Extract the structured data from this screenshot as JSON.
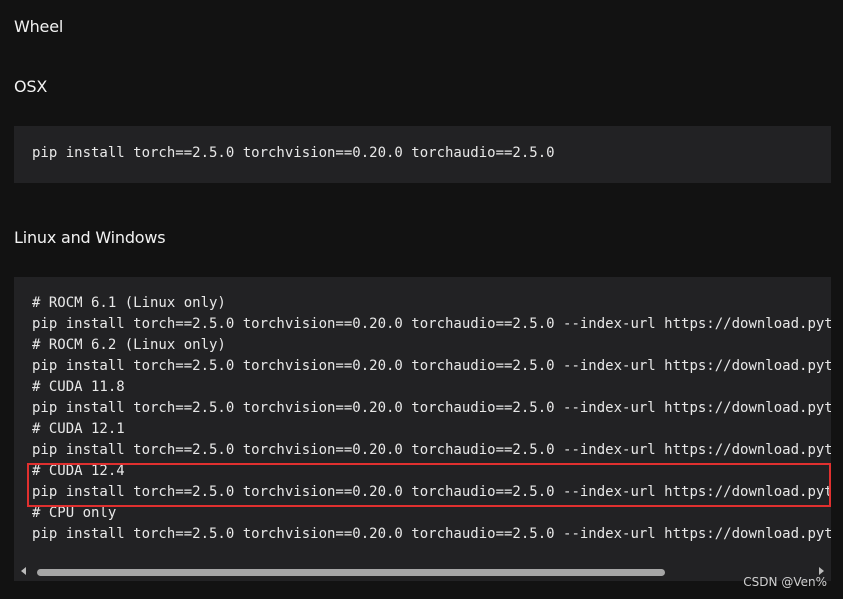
{
  "headings": {
    "wheel": "Wheel",
    "osx": "OSX",
    "linux_windows": "Linux and Windows"
  },
  "osx_code": "pip install torch==2.5.0 torchvision==0.20.0 torchaudio==2.5.0",
  "linux_code_lines": [
    "# ROCM 6.1 (Linux only)",
    "pip install torch==2.5.0 torchvision==0.20.0 torchaudio==2.5.0 --index-url https://download.pyt",
    "# ROCM 6.2 (Linux only)",
    "pip install torch==2.5.0 torchvision==0.20.0 torchaudio==2.5.0 --index-url https://download.pyt",
    "# CUDA 11.8",
    "pip install torch==2.5.0 torchvision==0.20.0 torchaudio==2.5.0 --index-url https://download.pyt",
    "# CUDA 12.1",
    "pip install torch==2.5.0 torchvision==0.20.0 torchaudio==2.5.0 --index-url https://download.pyt",
    "# CUDA 12.4",
    "pip install torch==2.5.0 torchvision==0.20.0 torchaudio==2.5.0 --index-url https://download.pyt",
    "# CPU only",
    "pip install torch==2.5.0 torchvision==0.20.0 torchaudio==2.5.0 --index-url https://download.pyt"
  ],
  "watermark": "CSDN @Ven%",
  "colors": {
    "page_bg": "#121212",
    "code_bg": "#222224",
    "highlight_border": "#e0302f"
  },
  "icons": {
    "scroll_left": "scroll-left-arrow-icon",
    "scroll_right": "scroll-right-arrow-icon"
  }
}
